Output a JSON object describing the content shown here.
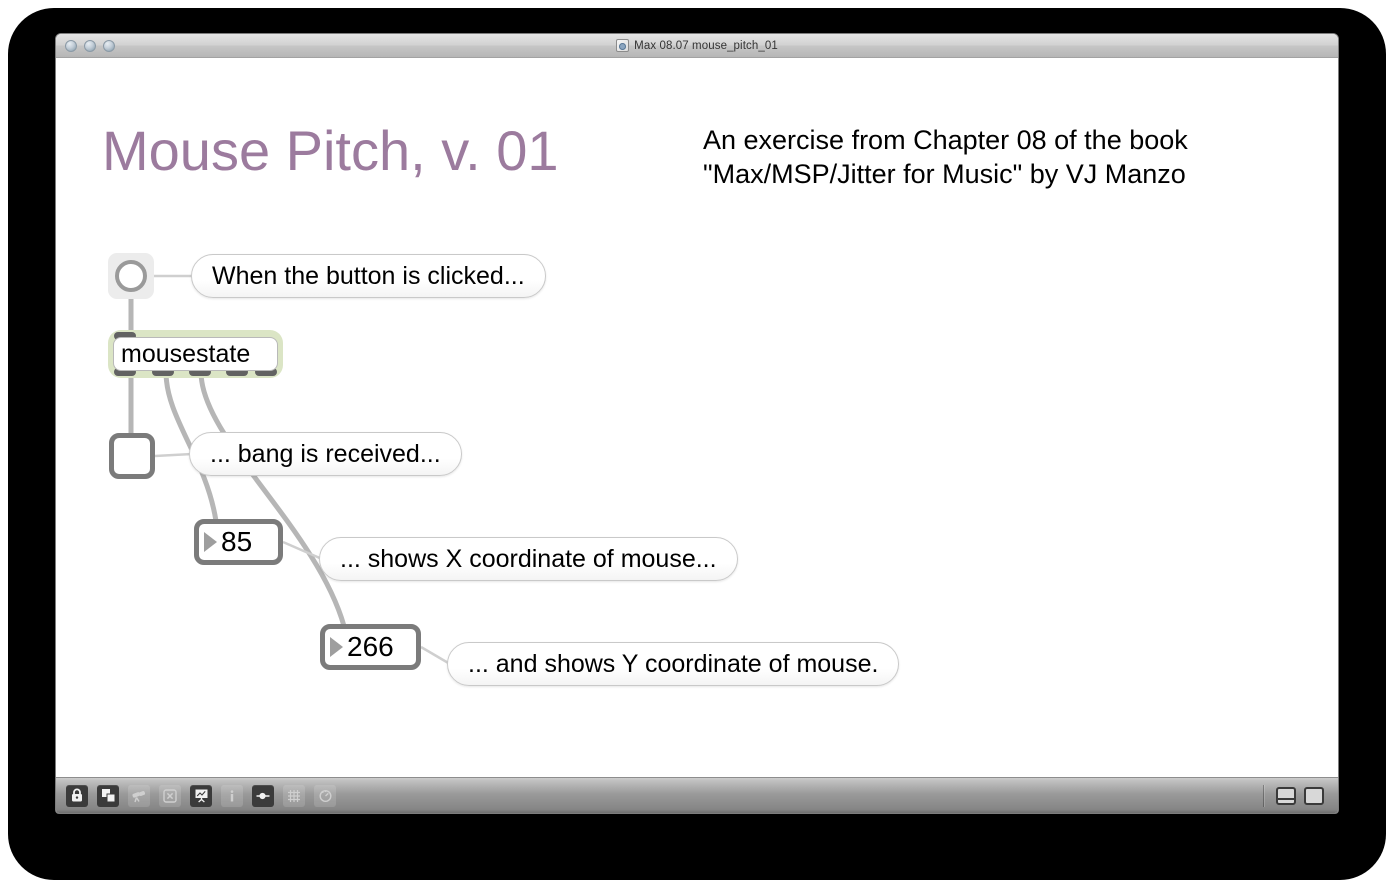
{
  "window": {
    "title": "Max 08.07 mouse_pitch_01",
    "title_icon": "max-document-icon",
    "traffic_lights": [
      "close-button",
      "minimize-button",
      "zoom-button"
    ]
  },
  "patch": {
    "title": "Mouse Pitch, v. 01",
    "title_color": "#9c7b9e",
    "subtitle_line_1": "An exercise from Chapter 08 of the book",
    "subtitle_line_2": "\"Max/MSP/Jitter for Music\" by VJ Manzo",
    "objects": {
      "bang": {
        "name": "bang-button",
        "label": ""
      },
      "mousestate": {
        "name": "mousestate-object",
        "text": "mousestate",
        "inlets": 1,
        "outlets": 5,
        "highlight_color": "#dbe5c5"
      },
      "toggle": {
        "name": "toggle-object",
        "state": "off"
      },
      "number_x": {
        "name": "number-box-x",
        "value": "85"
      },
      "number_y": {
        "name": "number-box-y",
        "value": "266"
      }
    },
    "comments": [
      {
        "name": "comment-bang-clicked",
        "text": "When the button is clicked..."
      },
      {
        "name": "comment-bang-received",
        "text": "... bang is received..."
      },
      {
        "name": "comment-x-coordinate",
        "text": "... shows X coordinate of mouse..."
      },
      {
        "name": "comment-y-coordinate",
        "text": "... and shows Y coordinate of mouse."
      }
    ]
  },
  "toolbar": {
    "buttons": [
      {
        "name": "lock-icon",
        "icon": "padlock",
        "state": "active"
      },
      {
        "name": "new-object-icon",
        "icon": "layers",
        "state": "active"
      },
      {
        "name": "telescope-icon",
        "icon": "telescope",
        "state": "disabled"
      },
      {
        "name": "clear-icon",
        "icon": "x-box",
        "state": "disabled"
      },
      {
        "name": "presentation-icon",
        "icon": "easel",
        "state": "active"
      },
      {
        "name": "info-icon",
        "icon": "info",
        "state": "disabled"
      },
      {
        "name": "inspector-icon",
        "icon": "inspector",
        "state": "active"
      },
      {
        "name": "grid-icon",
        "icon": "grid",
        "state": "disabled"
      },
      {
        "name": "debug-icon",
        "icon": "debug-clock",
        "state": "disabled"
      }
    ],
    "view_buttons": [
      {
        "name": "split-view-button",
        "icon": "split-pane"
      },
      {
        "name": "full-view-button",
        "icon": "full-pane"
      }
    ]
  }
}
